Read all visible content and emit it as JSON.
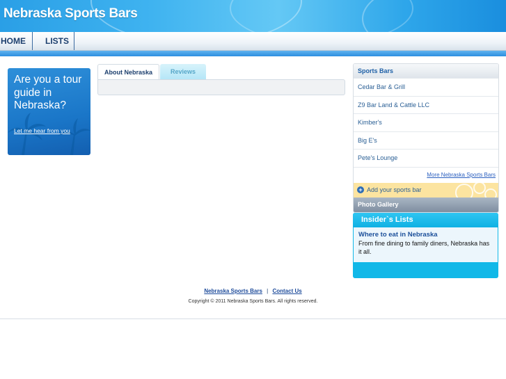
{
  "header": {
    "site_title": "Nebraska Sports Bars"
  },
  "nav": {
    "items": [
      {
        "label": "HOME"
      },
      {
        "label": "LISTS"
      }
    ]
  },
  "promo": {
    "text": "Are you a tour guide in Nebraska?",
    "link": "Let me hear from you"
  },
  "tabs": [
    {
      "label": "About Nebraska",
      "active": true
    },
    {
      "label": "Reviews",
      "active": false
    }
  ],
  "sidebar": {
    "heading": "Sports Bars",
    "items": [
      {
        "label": "Cedar Bar & Grill"
      },
      {
        "label": "Z9 Bar Land & Cattle LLC"
      },
      {
        "label": "Kimber's"
      },
      {
        "label": "Big E's"
      },
      {
        "label": "Pete's Lounge"
      }
    ],
    "more_link": "More Nebraska Sports Bars",
    "add_label": "Add your sports bar",
    "photo_gallery": "Photo Gallery"
  },
  "insider": {
    "heading": "Insider`s Lists",
    "title": "Where to eat in Nebraska",
    "description": "From fine dining to family diners, Nebraska has it all."
  },
  "footer": {
    "links": [
      {
        "label": "Nebraska Sports Bars"
      },
      {
        "label": "Contact Us"
      }
    ],
    "separator": "|",
    "copyright": "Copyright © 2011 Nebraska Sports Bars. All rights reserved."
  },
  "colors": {
    "header_blue": "#2a9fe6",
    "accent_cyan": "#11b8e8",
    "link_blue": "#1c4a9a",
    "add_yellow": "#fce4a0"
  }
}
